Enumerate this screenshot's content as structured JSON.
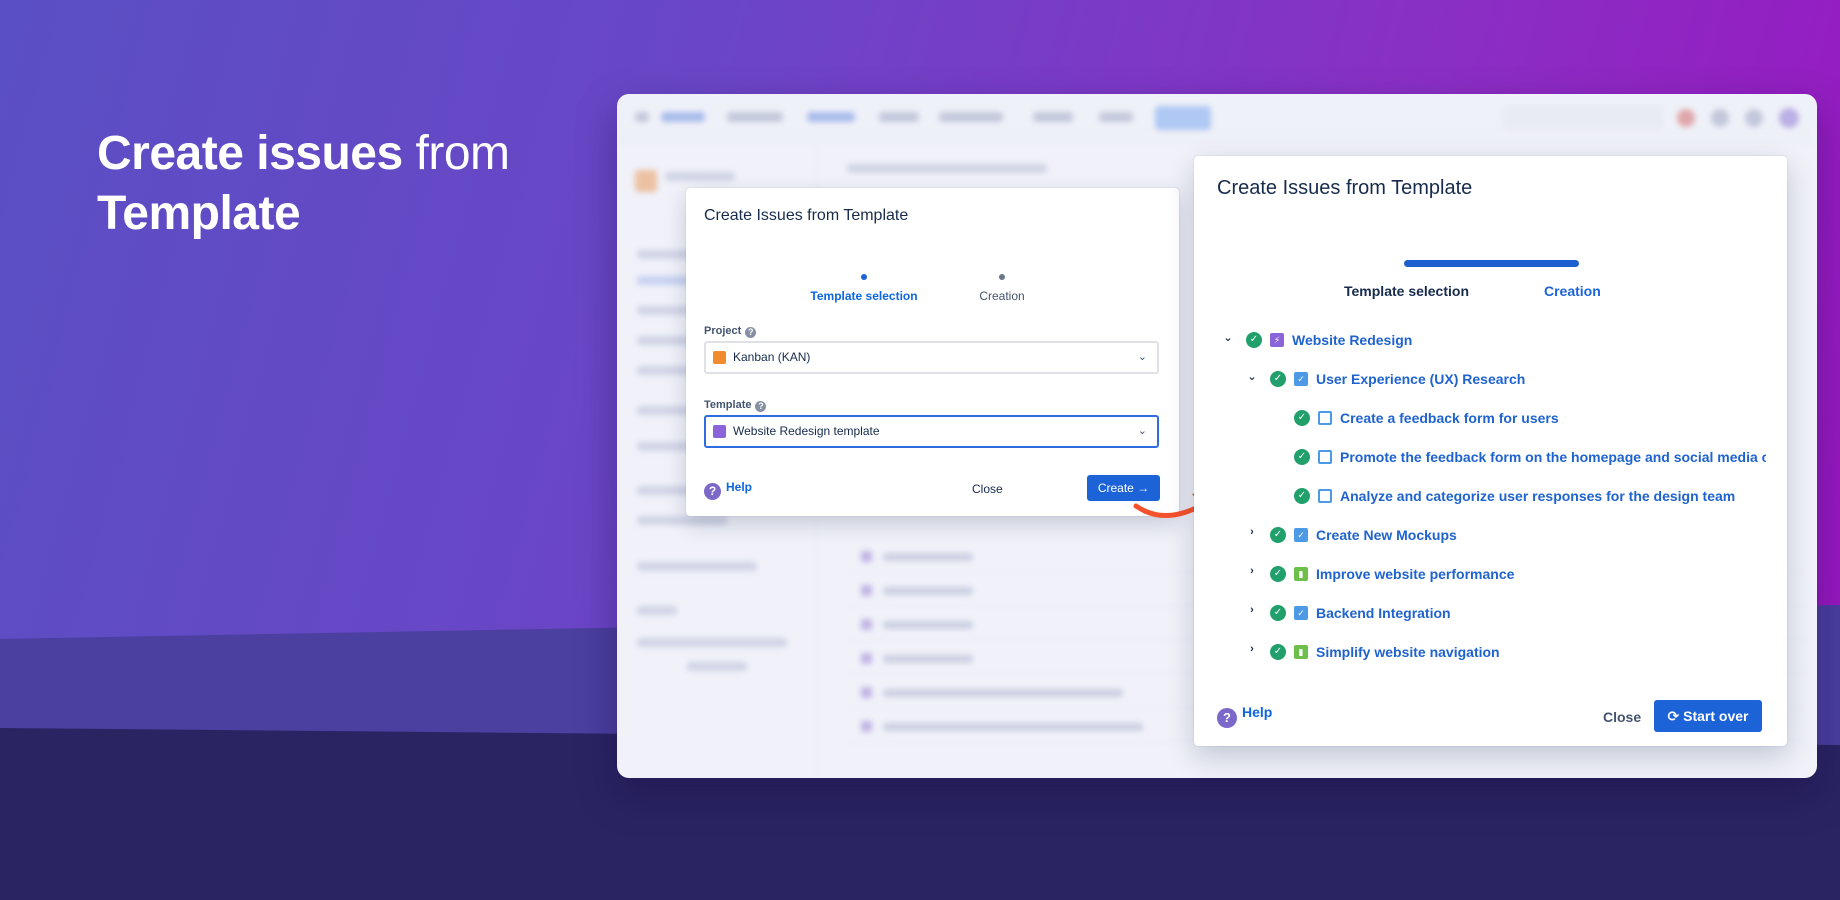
{
  "hero": {
    "bold1": "Create issues",
    "light": "from",
    "bold2": "Template"
  },
  "dialog_small": {
    "title": "Create Issues from Template",
    "steps": [
      {
        "label": "Template selection",
        "active": true
      },
      {
        "label": "Creation",
        "active": false
      }
    ],
    "project": {
      "label": "Project",
      "value": "Kanban (KAN)",
      "icon": "kanban-project-icon"
    },
    "template": {
      "label": "Template",
      "value": "Website Redesign template",
      "icon": "epic-icon"
    },
    "help": "Help",
    "close": "Close",
    "create": "Create"
  },
  "dialog_large": {
    "title": "Create Issues from Template",
    "progress": 1.0,
    "steps": [
      {
        "label": "Template selection"
      },
      {
        "label": "Creation"
      }
    ],
    "tree": [
      {
        "label": "Website Redesign",
        "type": "epic",
        "toggle": "expanded",
        "done": true
      },
      {
        "label": "User Experience (UX) Research",
        "type": "task",
        "toggle": "expanded",
        "done": true
      },
      {
        "label": "Create a feedback form for users",
        "type": "subtask",
        "toggle": "none",
        "done": true
      },
      {
        "label": "Promote the feedback form on the homepage and social media ch",
        "type": "subtask",
        "toggle": "none",
        "done": true
      },
      {
        "label": "Analyze and categorize user responses for the design team",
        "type": "subtask",
        "toggle": "none",
        "done": true
      },
      {
        "label": "Create New Mockups",
        "type": "task",
        "toggle": "collapsed",
        "done": true
      },
      {
        "label": "Improve website performance",
        "type": "story",
        "toggle": "collapsed",
        "done": true
      },
      {
        "label": "Backend Integration",
        "type": "task",
        "toggle": "collapsed",
        "done": true
      },
      {
        "label": "Simplify website navigation",
        "type": "story",
        "toggle": "collapsed",
        "done": true
      }
    ],
    "help": "Help",
    "close": "Close",
    "start_over": "Start over"
  },
  "colors": {
    "primary": "#1d63d8",
    "success": "#22a06b",
    "arrow": "#f4512c"
  }
}
